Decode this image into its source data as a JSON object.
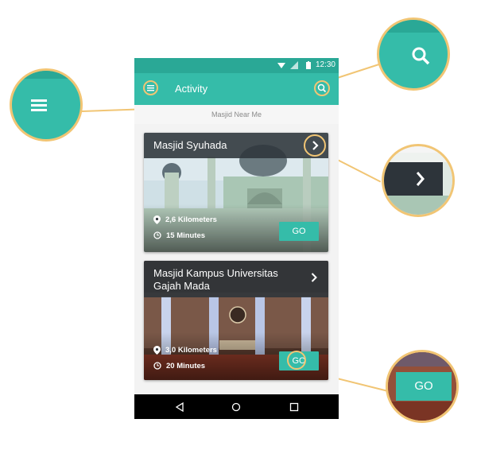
{
  "statusbar": {
    "time": "12:30"
  },
  "appbar": {
    "title": "Activity",
    "menu_icon": "menu-icon",
    "search_icon": "search-icon"
  },
  "subheader": "Masjid Near Me",
  "cards": [
    {
      "name": "Masjid Syuhada",
      "distance": "2,6 Kilometers",
      "time": "15 Minutes",
      "go": "GO"
    },
    {
      "name": "Masjid Kampus Universitas Gajah Mada",
      "distance": "3,0 Kilometers",
      "time": "20 Minutes",
      "go": "GO"
    }
  ],
  "callouts": {
    "go_label": "GO"
  },
  "colors": {
    "primary": "#35bca9",
    "statusbar": "#2aa896",
    "highlight": "#f1c574",
    "cardbar": "#2d343a"
  }
}
